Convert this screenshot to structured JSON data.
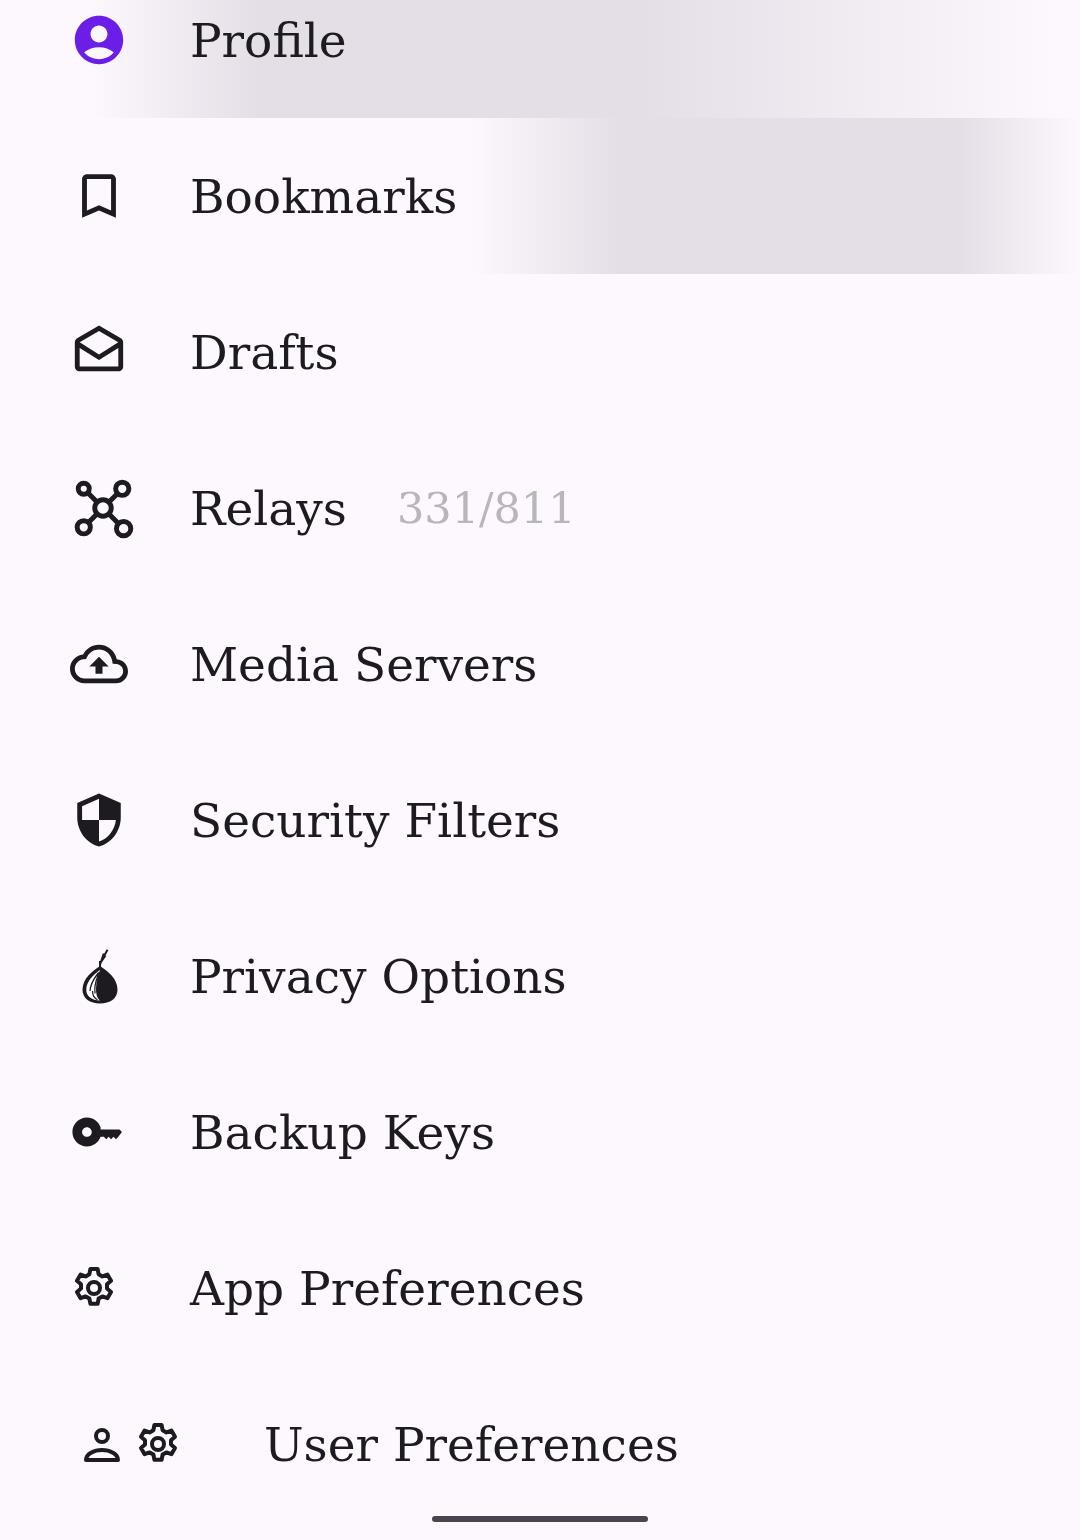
{
  "menu": {
    "items": [
      {
        "label": "Profile",
        "highlighted": true
      },
      {
        "label": "Bookmarks",
        "highlighted": true
      },
      {
        "label": "Drafts",
        "highlighted": false
      },
      {
        "label": "Relays",
        "highlighted": false,
        "count": "331/811"
      },
      {
        "label": "Media Servers",
        "highlighted": false
      },
      {
        "label": "Security Filters",
        "highlighted": false
      },
      {
        "label": "Privacy Options",
        "highlighted": false
      },
      {
        "label": "Backup Keys",
        "highlighted": false
      },
      {
        "label": "App Preferences",
        "highlighted": false
      },
      {
        "label": "User Preferences",
        "highlighted": false
      }
    ]
  }
}
